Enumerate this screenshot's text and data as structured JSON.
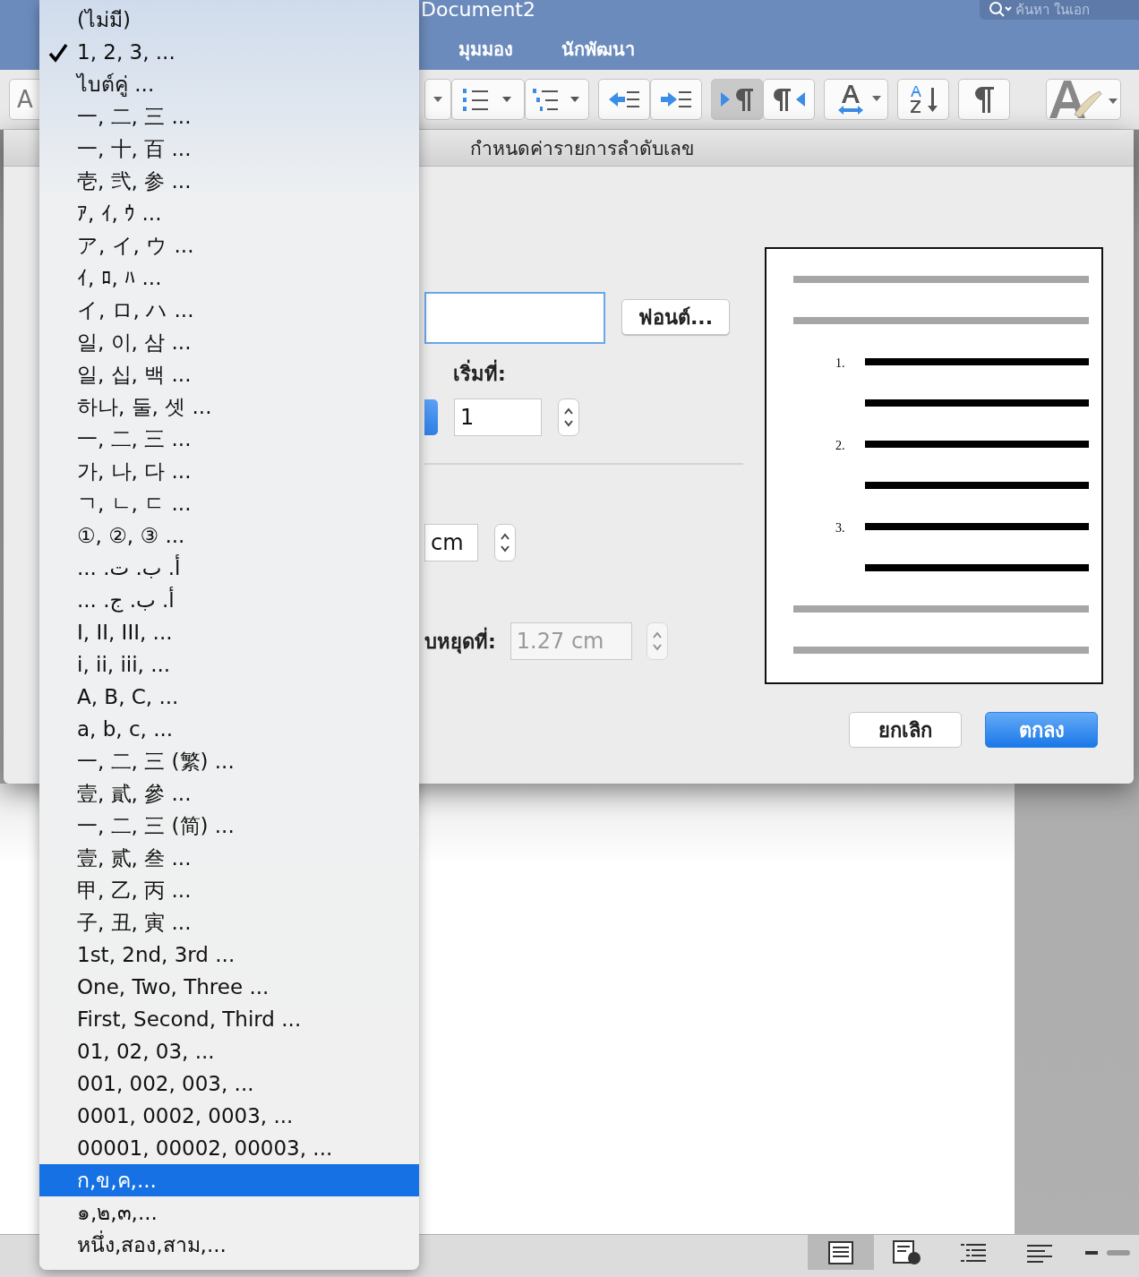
{
  "window": {
    "title": "Document2",
    "search": {
      "placeholder": "ค้นหา ในเอก"
    }
  },
  "ribbon_tabs": [
    {
      "label": "มุมมอง",
      "selected": false
    },
    {
      "label": "นักพัฒนา",
      "selected": false
    }
  ],
  "toolbar": {
    "font_button": {
      "label": "A"
    },
    "items": [
      {
        "kind": "dropdown-arrow",
        "pressed": false
      },
      {
        "kind": "numbered-list",
        "pressed": false
      },
      {
        "kind": "multilevel-list",
        "pressed": false
      },
      {
        "kind": "outdent",
        "pressed": false
      },
      {
        "kind": "indent",
        "pressed": false
      },
      {
        "kind": "ltr",
        "pressed": true
      },
      {
        "kind": "rtl",
        "pressed": false
      },
      {
        "kind": "text-direction",
        "pressed": false
      },
      {
        "kind": "sort",
        "pressed": false
      },
      {
        "kind": "pilcrow",
        "pressed": false
      },
      {
        "kind": "styles",
        "pressed": false
      }
    ]
  },
  "dialog": {
    "title": "กำหนดค่ารายการลำดับเลข",
    "format_field": {
      "focused": true
    },
    "font_button": "ฟอนต์...",
    "start_at": {
      "label": "เริ่มที่:",
      "value": "1"
    },
    "indent_field": {
      "value": "cm"
    },
    "tab_stop": {
      "label": "บหยุดที่:",
      "value": "1.27 cm",
      "disabled": true
    },
    "preview": {
      "numbers": [
        "1.",
        "2.",
        "3."
      ]
    },
    "buttons": [
      {
        "label": "ยกเลิก",
        "primary": false
      },
      {
        "label": "ตกลง",
        "primary": true
      }
    ]
  },
  "number_styles": [
    {
      "label": "(ไม่มี)",
      "checked": false,
      "selected": false
    },
    {
      "label": "1, 2, 3, ...",
      "checked": true,
      "selected": false
    },
    {
      "label": "ไบต์คู่ ...",
      "checked": false,
      "selected": false
    },
    {
      "label": "一, 二, 三 ...",
      "checked": false,
      "selected": false
    },
    {
      "label": "一, 十, 百 ...",
      "checked": false,
      "selected": false
    },
    {
      "label": "壱, 弐, 参 ...",
      "checked": false,
      "selected": false
    },
    {
      "label": "ｱ, ｲ, ｳ ...",
      "checked": false,
      "selected": false
    },
    {
      "label": "ア, イ, ウ ...",
      "checked": false,
      "selected": false
    },
    {
      "label": "ｲ, ﾛ, ﾊ ...",
      "checked": false,
      "selected": false
    },
    {
      "label": "イ, ロ, ハ ...",
      "checked": false,
      "selected": false
    },
    {
      "label": "일, 이, 삼 ...",
      "checked": false,
      "selected": false
    },
    {
      "label": "일, 십, 백 ...",
      "checked": false,
      "selected": false
    },
    {
      "label": "하나, 둘, 셋 ...",
      "checked": false,
      "selected": false
    },
    {
      "label": "一, 二, 三 ...",
      "checked": false,
      "selected": false
    },
    {
      "label": "가, 나, 다 ...",
      "checked": false,
      "selected": false
    },
    {
      "label": "ㄱ, ㄴ, ㄷ ...",
      "checked": false,
      "selected": false
    },
    {
      "label": "①, ②, ③ ...",
      "checked": false,
      "selected": false
    },
    {
      "label": "أ. ب. ت. ...",
      "checked": false,
      "selected": false
    },
    {
      "label": "أ. ب. ج. ...",
      "checked": false,
      "selected": false
    },
    {
      "label": "I, II, III, ...",
      "checked": false,
      "selected": false
    },
    {
      "label": "i, ii, iii, ...",
      "checked": false,
      "selected": false
    },
    {
      "label": "A, B, C, ...",
      "checked": false,
      "selected": false
    },
    {
      "label": "a, b, c, ...",
      "checked": false,
      "selected": false
    },
    {
      "label": "一, 二, 三 (繁) ...",
      "checked": false,
      "selected": false
    },
    {
      "label": "壹, 貳, 參 ...",
      "checked": false,
      "selected": false
    },
    {
      "label": "一, 二, 三 (简) ...",
      "checked": false,
      "selected": false
    },
    {
      "label": "壹, 贰, 叁 ...",
      "checked": false,
      "selected": false
    },
    {
      "label": "甲, 乙, 丙 ...",
      "checked": false,
      "selected": false
    },
    {
      "label": "子, 丑, 寅 ...",
      "checked": false,
      "selected": false
    },
    {
      "label": "1st, 2nd, 3rd ...",
      "checked": false,
      "selected": false
    },
    {
      "label": "One, Two, Three ...",
      "checked": false,
      "selected": false
    },
    {
      "label": "First, Second, Third ...",
      "checked": false,
      "selected": false
    },
    {
      "label": "01, 02, 03, ...",
      "checked": false,
      "selected": false
    },
    {
      "label": "001, 002, 003, ...",
      "checked": false,
      "selected": false
    },
    {
      "label": "0001, 0002, 0003, ...",
      "checked": false,
      "selected": false
    },
    {
      "label": "00001, 00002, 00003, ...",
      "checked": false,
      "selected": false
    },
    {
      "label": "ก,ข,ค,...",
      "checked": false,
      "selected": true
    },
    {
      "label": "๑,๒,๓,...",
      "checked": false,
      "selected": false
    },
    {
      "label": "หนึ่ง,สอง,สาม,...",
      "checked": false,
      "selected": false
    }
  ],
  "status_bar": {
    "views": [
      {
        "kind": "print-layout",
        "selected": true
      },
      {
        "kind": "web-layout",
        "selected": false
      },
      {
        "kind": "outline",
        "selected": false
      },
      {
        "kind": "draft",
        "selected": false
      }
    ]
  }
}
